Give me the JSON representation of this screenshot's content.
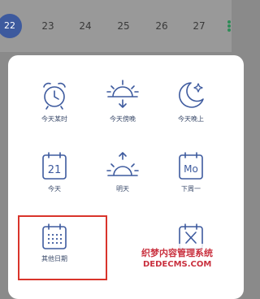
{
  "date_strip": {
    "dates": [
      "22",
      "23",
      "24",
      "25",
      "26",
      "27"
    ],
    "selected": "22"
  },
  "options": [
    {
      "label": "今天某时",
      "icon": "alarm-clock-icon"
    },
    {
      "label": "今天傍晚",
      "icon": "sunset-icon"
    },
    {
      "label": "今天晚上",
      "icon": "moon-star-icon"
    },
    {
      "label": "今天",
      "icon": "calendar-date-icon",
      "icon_text": "21"
    },
    {
      "label": "明天",
      "icon": "sunrise-icon"
    },
    {
      "label": "下周一",
      "icon": "calendar-weekday-icon",
      "icon_text": "Mo"
    },
    {
      "label": "其他日期",
      "icon": "calendar-grid-icon"
    },
    {
      "label": "",
      "icon": "calendar-clear-icon"
    }
  ],
  "colors": {
    "icon": "#3d5a9e",
    "highlight": "#d9342b",
    "overlay": "#8a8a8a",
    "watermark": "#c9303e"
  },
  "watermark": {
    "line1": "织梦内容管理系统",
    "line2": "DEDECMS.COM"
  }
}
